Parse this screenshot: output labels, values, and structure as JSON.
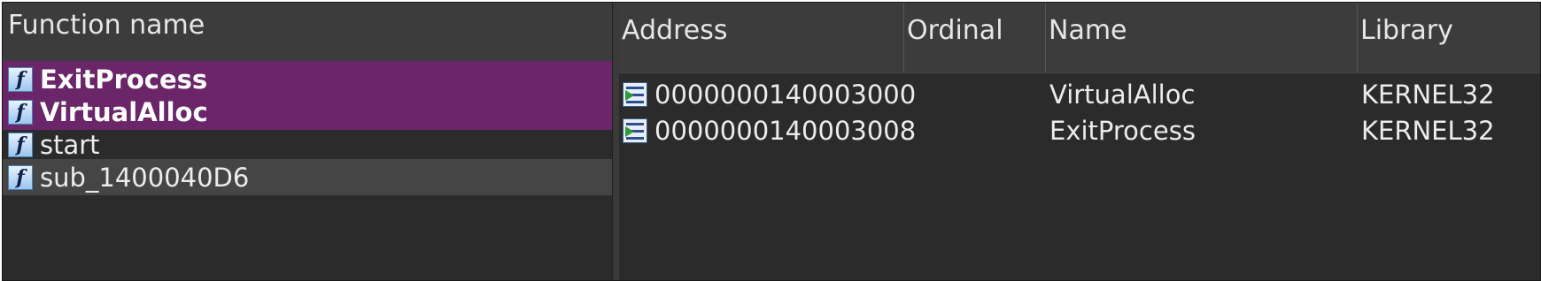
{
  "functions_pane": {
    "header": "Function name",
    "rows": [
      {
        "name": "ExitProcess",
        "style": "highlight"
      },
      {
        "name": "VirtualAlloc",
        "style": "highlight"
      },
      {
        "name": "start",
        "style": "normal"
      },
      {
        "name": "sub_1400040D6",
        "style": "selected"
      }
    ],
    "icon": "function-f-icon"
  },
  "imports_pane": {
    "columns": [
      "Address",
      "Ordinal",
      "Name",
      "Library"
    ],
    "rows": [
      {
        "address": "0000000140003000",
        "ordinal": "",
        "name": "VirtualAlloc",
        "library": "KERNEL32"
      },
      {
        "address": "0000000140003008",
        "ordinal": "",
        "name": "ExitProcess",
        "library": "KERNEL32"
      }
    ],
    "icon": "import-entry-icon"
  },
  "colors": {
    "highlight": "#6a2669",
    "selected": "#454545",
    "background": "#2b2b2b",
    "header": "#3c3c3c"
  }
}
